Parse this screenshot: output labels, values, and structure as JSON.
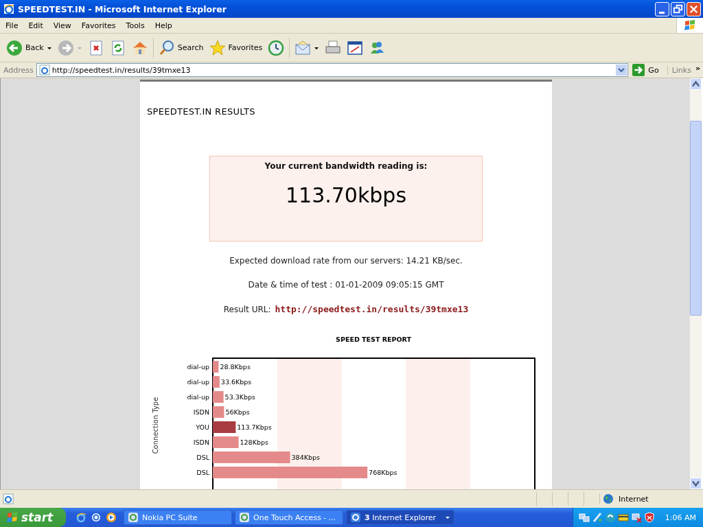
{
  "window": {
    "title": "SPEEDTEST.IN - Microsoft Internet Explorer"
  },
  "menu": [
    "File",
    "Edit",
    "View",
    "Favorites",
    "Tools",
    "Help"
  ],
  "toolbar": [
    {
      "kind": "back",
      "label": "Back"
    },
    {
      "kind": "forward"
    },
    {
      "kind": "stop"
    },
    {
      "kind": "refresh"
    },
    {
      "kind": "home"
    },
    {
      "kind": "search",
      "label": "Search"
    },
    {
      "kind": "favorites",
      "label": "Favorites"
    },
    {
      "kind": "history"
    },
    {
      "kind": "mail"
    },
    {
      "kind": "print"
    },
    {
      "kind": "edit"
    },
    {
      "kind": "messenger"
    }
  ],
  "address_bar": {
    "label": "Address",
    "value": "http://speedtest.in/results/39tmxe13",
    "go": "Go",
    "links": "Links",
    "more": "»"
  },
  "page": {
    "heading": "SPEEDTEST.IN RESULTS",
    "reading_label": "Your current bandwidth reading is:",
    "reading": "113.70kbps",
    "download": "Expected download rate from our servers: 14.21 KB/sec.",
    "date": "Date & time of test : 01-01-2009 09:05:15 GMT",
    "result_label": "Result URL:",
    "result_url": "http://speedtest.in/results/39tmxe13",
    "chart_data": {
      "type": "bar",
      "orientation": "horizontal",
      "title": "SPEED TEST REPORT",
      "ylabel": "Connection Type",
      "categories": [
        "dial-up",
        "dial-up",
        "dial-up",
        "ISDN",
        "YOU",
        "ISDN",
        "DSL",
        "DSL"
      ],
      "series": [
        {
          "color": "#e58a8a",
          "values": [
            28.8,
            33.6,
            53.3,
            56,
            null,
            128,
            384,
            768
          ],
          "value_labels": [
            "28.8Kbps",
            "33.6Kbps",
            "53.3Kbps",
            "56Kbps",
            null,
            "128Kbps",
            "384Kbps",
            "768Kbps"
          ]
        },
        {
          "color": "#a83c42",
          "values": [
            null,
            null,
            null,
            null,
            113.7,
            null,
            null,
            null
          ],
          "value_labels": [
            null,
            null,
            null,
            null,
            "113.7Kbps",
            null,
            null,
            null
          ]
        }
      ]
    }
  },
  "status_bar": {
    "zone": "Internet"
  },
  "taskbar": {
    "start": "start",
    "tasks": [
      {
        "label": "Nokia PC Suite",
        "selected": false
      },
      {
        "label": "One Touch Access - ...",
        "selected": false
      },
      {
        "label": "**3** Internet Explorer",
        "selected": true
      }
    ],
    "clock": "1:06 AM"
  }
}
